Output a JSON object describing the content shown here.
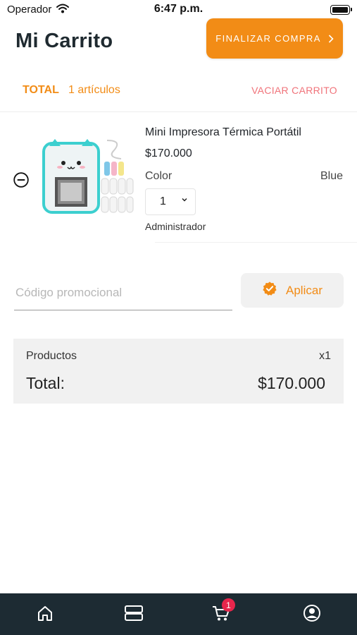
{
  "status_bar": {
    "carrier": "Operador",
    "time": "6:47 p.m."
  },
  "header": {
    "title": "Mi Carrito",
    "checkout_label": "FINALIZAR COMPRA"
  },
  "summary": {
    "total_label": "TOTAL",
    "items_count": "1 artículos",
    "clear_label": "VACIAR CARRITO"
  },
  "cart_items": [
    {
      "name": "Mini Impresora Térmica Portátil",
      "price": "$170.000",
      "color_label": "Color",
      "color_value": "Blue",
      "quantity": "1",
      "seller": "Administrador"
    }
  ],
  "promo": {
    "placeholder": "Código promocional",
    "apply_label": "Aplicar"
  },
  "totals": {
    "products_label": "Productos",
    "products_qty": "x1",
    "total_label": "Total:",
    "total_value": "$170.000"
  },
  "bottom_nav": {
    "cart_badge": "1"
  },
  "colors": {
    "accent": "#f28c16",
    "clear": "#f0737a",
    "nav_bg": "#1d2b33",
    "badge": "#e8264c"
  },
  "icons": [
    "wifi-icon",
    "battery-icon",
    "chevron-right-icon",
    "remove-circle-icon",
    "chevron-down-icon",
    "verified-badge-icon",
    "home-icon",
    "catalog-icon",
    "cart-icon",
    "profile-icon"
  ]
}
